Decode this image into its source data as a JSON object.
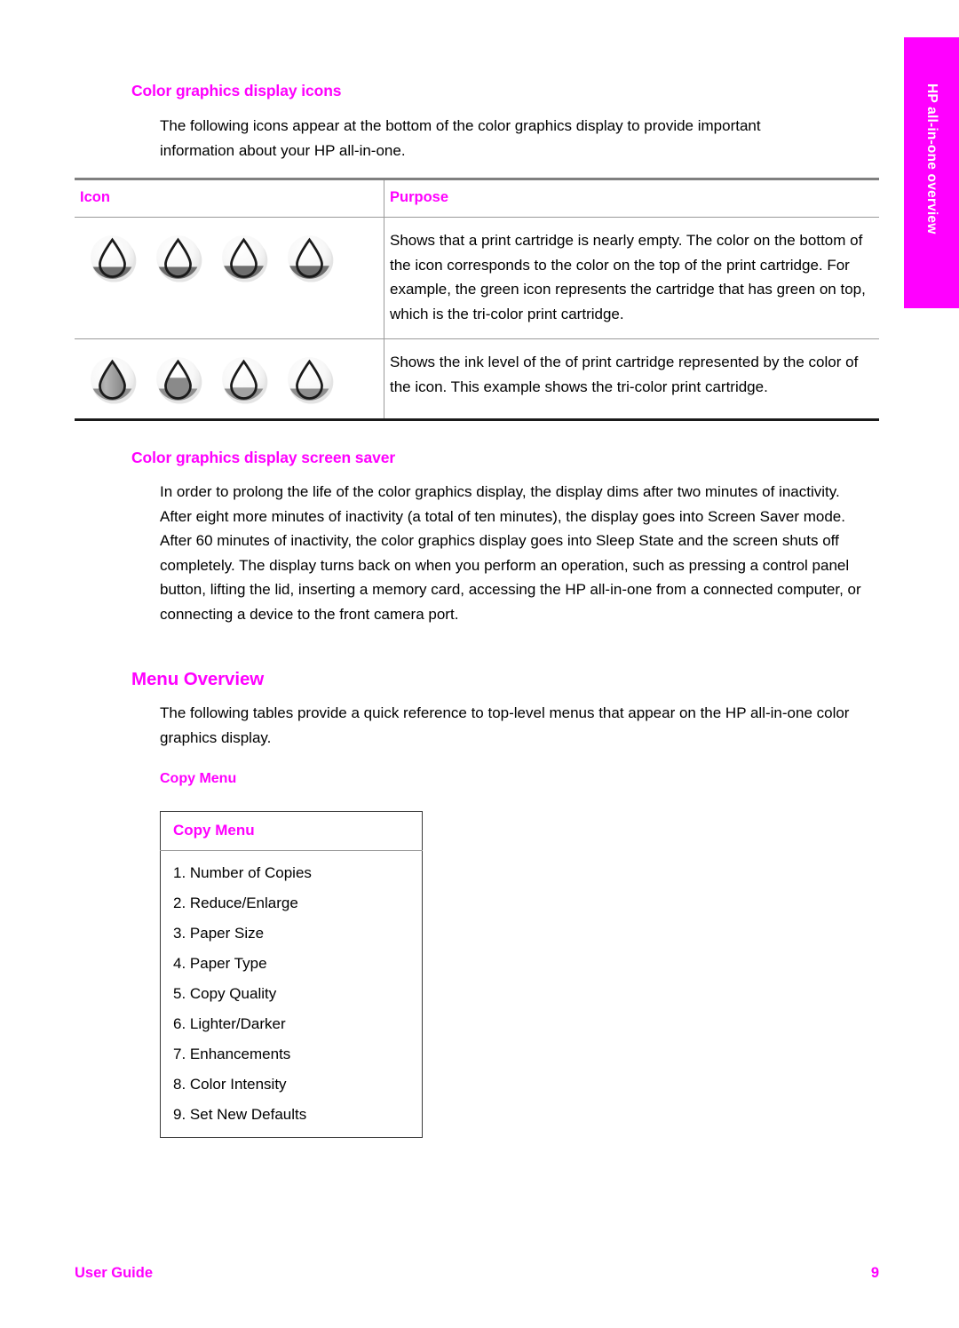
{
  "side_tab": {
    "label": "HP all-in-one overview",
    "background": "#ff00ff",
    "text_color": "#ffffff"
  },
  "accent_color": "#ff00ff",
  "sections": {
    "icons": {
      "heading": "Color graphics display icons",
      "intro": "The following icons appear at the bottom of the color graphics display to provide important information about your HP all-in-one.",
      "table": {
        "headers": [
          "Icon",
          "Purpose"
        ],
        "rows": [
          {
            "icon_name": "ink-drop-empty-icons",
            "icon_count": 4,
            "icon_fill_levels": [
              0.12,
              0.1,
              0.1,
              0.1
            ],
            "purpose": "Shows that a print cartridge is nearly empty. The color on the bottom of the icon corresponds to the color on the top of the print cartridge. For example, the green icon represents the cartridge that has green on top, which is the tri-color print cartridge."
          },
          {
            "icon_name": "ink-level-icons",
            "icon_count": 4,
            "icon_fill_levels": [
              1.0,
              0.62,
              0.34,
              0.1
            ],
            "purpose": "Shows the ink level of the of print cartridge represented by the color of the icon. This example shows the tri-color print cartridge."
          }
        ]
      }
    },
    "screen_saver": {
      "heading": "Color graphics display screen saver",
      "paragraph": "In order to prolong the life of the color graphics display, the display dims after two minutes of inactivity. After eight more minutes of inactivity (a total of ten minutes), the display goes into Screen Saver mode. After 60 minutes of inactivity, the color graphics display goes into Sleep State and the screen shuts off completely. The display turns back on when you perform an operation, such as pressing a control panel button, lifting the lid, inserting a memory card, accessing the HP all-in-one from a connected computer, or connecting a device to the front camera port."
    },
    "menu_overview": {
      "heading": "Menu Overview",
      "paragraph": "The following tables provide a quick reference to top-level menus that appear on the HP all-in-one color graphics display.",
      "subheading": "Copy Menu",
      "copy_menu": {
        "title": "Copy Menu",
        "items": [
          "1. Number of Copies",
          "2. Reduce/Enlarge",
          "3. Paper Size",
          "4. Paper Type",
          "5. Copy Quality",
          "6. Lighter/Darker",
          "7. Enhancements",
          "8. Color Intensity",
          "9. Set New Defaults"
        ]
      }
    }
  },
  "footer": {
    "left": "User Guide",
    "page_number": "9"
  }
}
